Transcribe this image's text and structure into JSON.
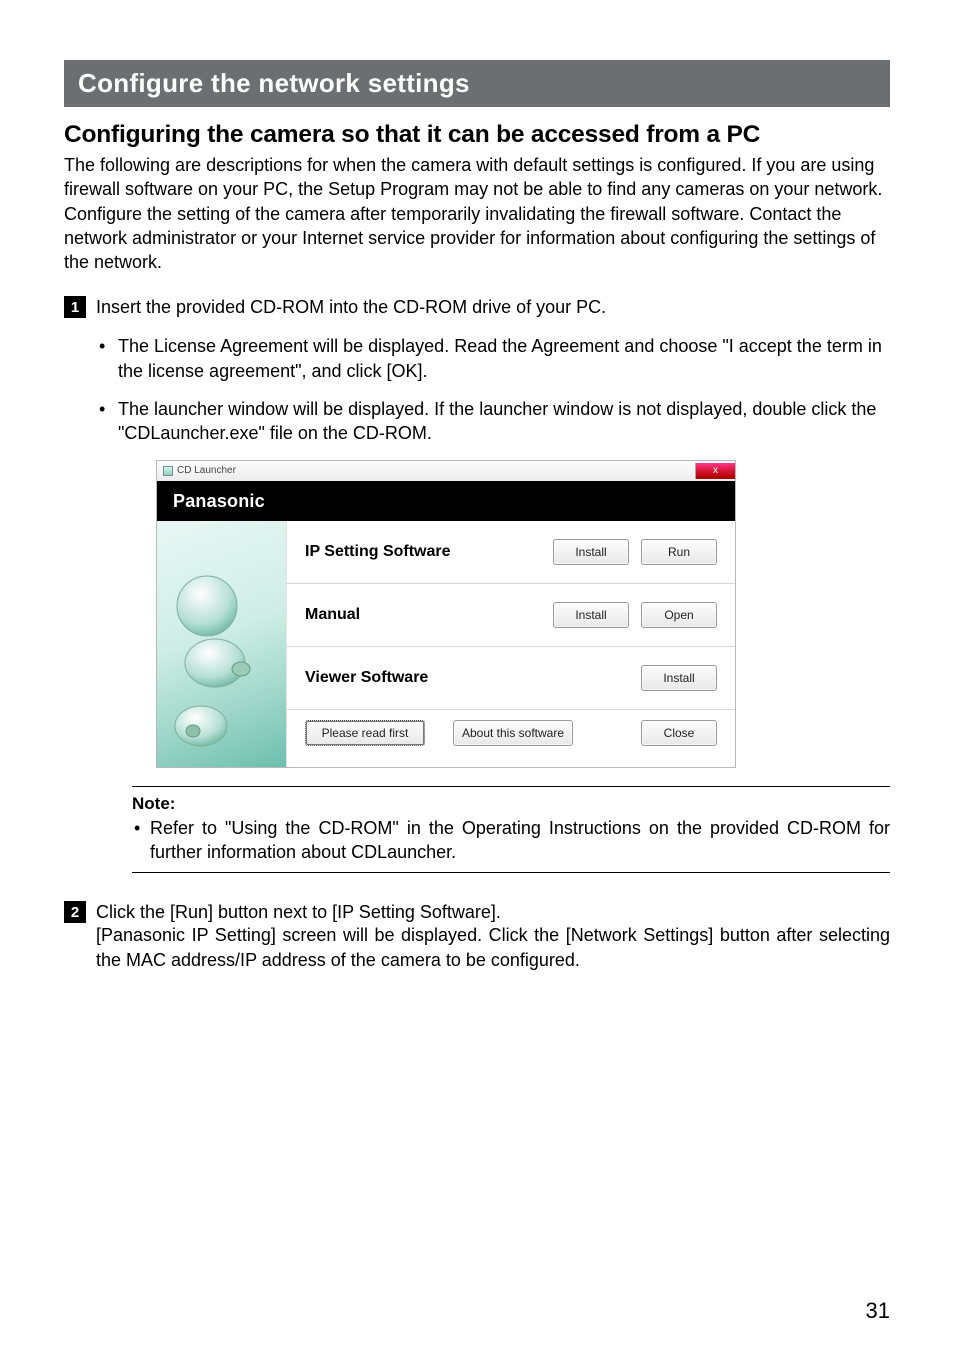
{
  "page_number": "31",
  "banner_title": "Configure the network settings",
  "subheading": "Configuring the camera so that it can be accessed from a PC",
  "intro_paragraph": "The following are descriptions for when the camera with default settings is configured. If you are using firewall software on your PC, the Setup Program may not be able to find any cameras on your network. Configure the setting of the camera after temporarily invalidating the firewall software. Contact the network administrator or your Internet service provider for information about configuring the settings of the network.",
  "steps": {
    "1": {
      "lead": "Insert the provided CD-ROM into the CD-ROM drive of your PC.",
      "bullets": [
        "The License Agreement will be displayed. Read the Agreement and choose \"I accept the term in the license agreement\", and click [OK].",
        "The launcher window will be displayed. If the launcher window is not displayed, double click the \"CDLauncher.exe\" file on the CD-ROM."
      ]
    },
    "2": {
      "lead": "Click the [Run] button next to [IP Setting Software].",
      "body2": "[Panasonic IP Setting] screen will be displayed. Click the [Network Settings] button after selecting the MAC address/IP address of the camera to be configured."
    }
  },
  "launcher": {
    "title": "CD Launcher",
    "brand": "Panasonic",
    "rows": [
      {
        "label": "IP Setting Software",
        "buttons": [
          "Install",
          "Run"
        ]
      },
      {
        "label": "Manual",
        "buttons": [
          "Install",
          "Open"
        ]
      },
      {
        "label": "Viewer Software",
        "buttons": [
          "Install"
        ]
      }
    ],
    "footer": {
      "read_first": "Please read first",
      "about": "About this software",
      "close": "Close"
    }
  },
  "note": {
    "label": "Note:",
    "items": [
      "Refer to \"Using the CD-ROM\" in the Operating Instructions on the provided CD-ROM for further information about CDLauncher."
    ]
  }
}
